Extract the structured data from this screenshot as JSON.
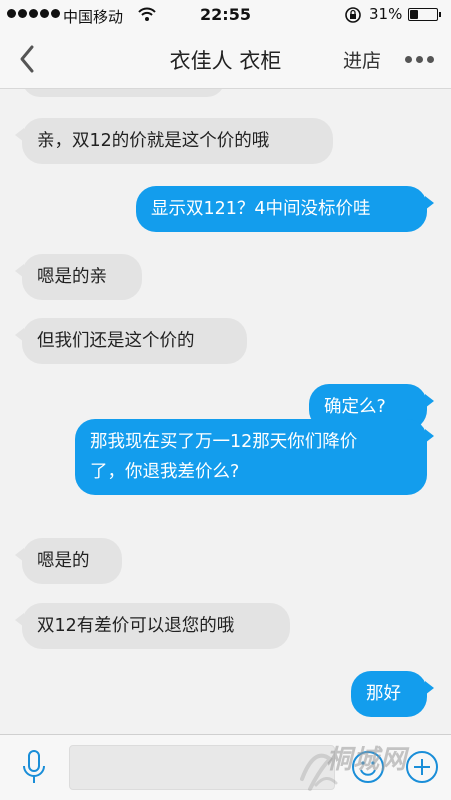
{
  "status_bar": {
    "carrier": "中国移动",
    "time": "22:55",
    "battery_percent": "31%",
    "battery_level": 0.31
  },
  "navbar": {
    "title": "衣佳人 衣柜",
    "store_label": "进店"
  },
  "messages": [
    {
      "side": "left",
      "text": "亲，双12的价就是这个价的哦"
    },
    {
      "side": "right",
      "text": "显示双121？4中间没标价哇"
    },
    {
      "side": "left",
      "text": "嗯是的亲"
    },
    {
      "side": "left",
      "text": "但我们还是这个价的"
    },
    {
      "side": "right",
      "text": "确定么?"
    },
    {
      "side": "right",
      "text": "那我现在买了万一12那天你们降价\n了，你退我差价么?"
    },
    {
      "side": "left",
      "text": "嗯是的"
    },
    {
      "side": "left",
      "text": "双12有差价可以退您的哦"
    },
    {
      "side": "right",
      "text": "那好"
    }
  ],
  "input": {
    "value": "",
    "placeholder": ""
  },
  "watermark": {
    "text": "桐城网"
  },
  "colors": {
    "outgoing_bubble": "#139ded",
    "incoming_bubble": "#e3e3e3",
    "accent_icon": "#1a8ed8"
  }
}
